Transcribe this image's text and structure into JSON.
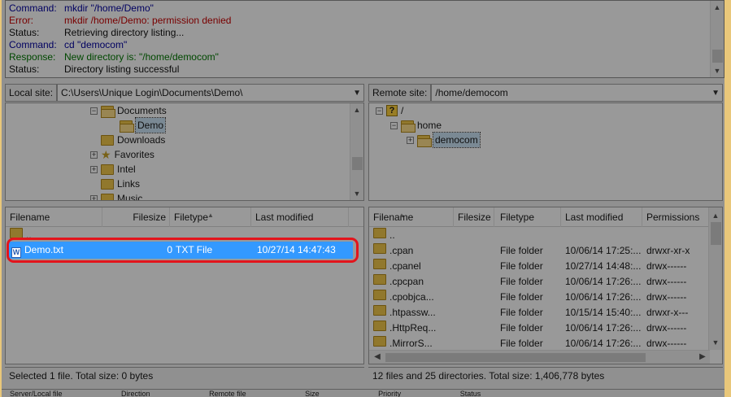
{
  "log": [
    {
      "key": "Command:",
      "value": "mkdir \"/home/Demo\"",
      "kind": "cmd"
    },
    {
      "key": "Error:",
      "value": "mkdir /home/Demo: permission denied",
      "kind": "err"
    },
    {
      "key": "Status:",
      "value": "Retrieving directory listing...",
      "kind": "stat"
    },
    {
      "key": "Command:",
      "value": "cd \"democom\"",
      "kind": "cmd"
    },
    {
      "key": "Response:",
      "value": "New directory is: \"/home/democom\"",
      "kind": "resp"
    },
    {
      "key": "Status:",
      "value": "Directory listing successful",
      "kind": "stat"
    }
  ],
  "local": {
    "site_label": "Local site:",
    "path": "C:\\Users\\Unique Login\\Documents\\Demo\\",
    "tree": [
      "Documents",
      "Demo",
      "Downloads",
      "Favorites",
      "Intel",
      "Links",
      "Music"
    ],
    "columns": {
      "name": "Filename",
      "size": "Filesize",
      "type": "Filetype",
      "modified": "Last modified"
    },
    "parent": "..",
    "file": {
      "name": "Demo.txt",
      "size": "0",
      "type": "TXT File",
      "modified": "10/27/14 14:47:43"
    },
    "status": "Selected 1 file. Total size: 0 bytes"
  },
  "remote": {
    "site_label": "Remote site:",
    "path": "/home/democom",
    "tree": [
      "/",
      "home",
      "democom"
    ],
    "columns": {
      "name": "Filename",
      "size": "Filesize",
      "type": "Filetype",
      "modified": "Last modified",
      "perms": "Permissions"
    },
    "rows": [
      {
        "name": "..",
        "type": "",
        "modified": "",
        "perms": ""
      },
      {
        "name": ".cpan",
        "type": "File folder",
        "modified": "10/06/14 17:25:...",
        "perms": "drwxr-xr-x"
      },
      {
        "name": ".cpanel",
        "type": "File folder",
        "modified": "10/27/14 14:48:...",
        "perms": "drwx------"
      },
      {
        "name": ".cpcpan",
        "type": "File folder",
        "modified": "10/06/14 17:26:...",
        "perms": "drwx------"
      },
      {
        "name": ".cpobjca...",
        "type": "File folder",
        "modified": "10/06/14 17:26:...",
        "perms": "drwx------"
      },
      {
        "name": ".htpassw...",
        "type": "File folder",
        "modified": "10/15/14 15:40:...",
        "perms": "drwxr-x---"
      },
      {
        "name": ".HttpReq...",
        "type": "File folder",
        "modified": "10/06/14 17:26:...",
        "perms": "drwx------"
      },
      {
        "name": ".MirrorS...",
        "type": "File folder",
        "modified": "10/06/14 17:26:...",
        "perms": "drwx------"
      }
    ],
    "status": "12 files and 25 directories. Total size: 1,406,778 bytes"
  },
  "queue": [
    "Server/Local file",
    "Direction",
    "Remote file",
    "Size",
    "Priority",
    "Status"
  ]
}
